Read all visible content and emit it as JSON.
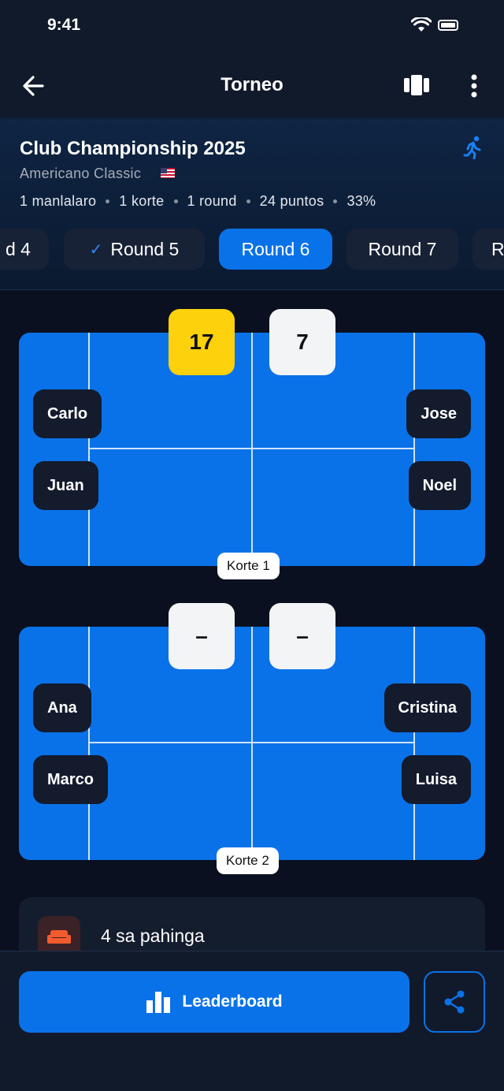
{
  "status_bar": {
    "time": "9:41"
  },
  "header": {
    "title": "Torneo"
  },
  "tournament": {
    "name": "Club Championship 2025",
    "format": "Americano Classic",
    "meta": [
      "1 manlalaro",
      "1 korte",
      "1 round",
      "24 puntos",
      "33%"
    ]
  },
  "rounds": {
    "tabs": [
      "d 4",
      "Round 5",
      "Round 6",
      "Round 7",
      "R"
    ],
    "completed": "Round 5",
    "active": "Round 6"
  },
  "courts": [
    {
      "label": "Korte 1",
      "team_a_score": "17",
      "team_b_score": "7",
      "team_a": [
        "Carlo",
        "Juan"
      ],
      "team_b": [
        "Jose",
        "Noel"
      ]
    },
    {
      "label": "Korte 2",
      "team_a_score": "–",
      "team_b_score": "–",
      "team_a": [
        "Ana",
        "Marco"
      ],
      "team_b": [
        "Cristina",
        "Luisa"
      ]
    }
  ],
  "resting": {
    "text": "4 sa pahinga"
  },
  "footer": {
    "leaderboard_label": "Leaderboard"
  },
  "colors": {
    "accent": "#0a72e8",
    "winner": "#fdd10b",
    "background": "#0a1020"
  }
}
